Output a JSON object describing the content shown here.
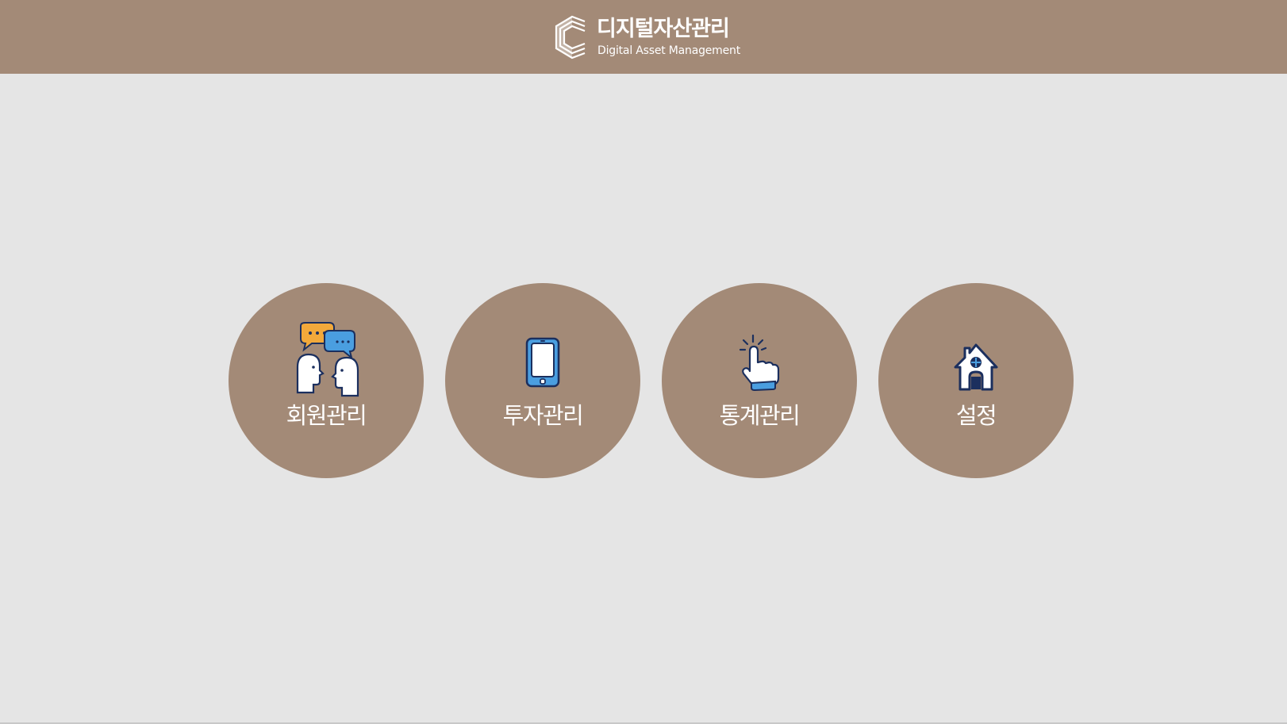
{
  "header": {
    "title": "디지털자산관리",
    "subtitle": "Digital Asset Management",
    "logo_icon": "c-logo-icon"
  },
  "menu": {
    "items": [
      {
        "label": "회원관리",
        "icon": "speech-bubbles-people-icon"
      },
      {
        "label": "투자관리",
        "icon": "smartphone-icon"
      },
      {
        "label": "통계관리",
        "icon": "pointing-hand-icon"
      },
      {
        "label": "설정",
        "icon": "house-icon"
      }
    ]
  },
  "colors": {
    "header_bg": "#a38a77",
    "page_bg": "#e5e5e5",
    "circle_bg": "#a38a77",
    "text": "#ffffff",
    "icon_navy": "#1b2f5e",
    "icon_blue": "#4a9ee0",
    "icon_orange": "#f2a93b"
  }
}
